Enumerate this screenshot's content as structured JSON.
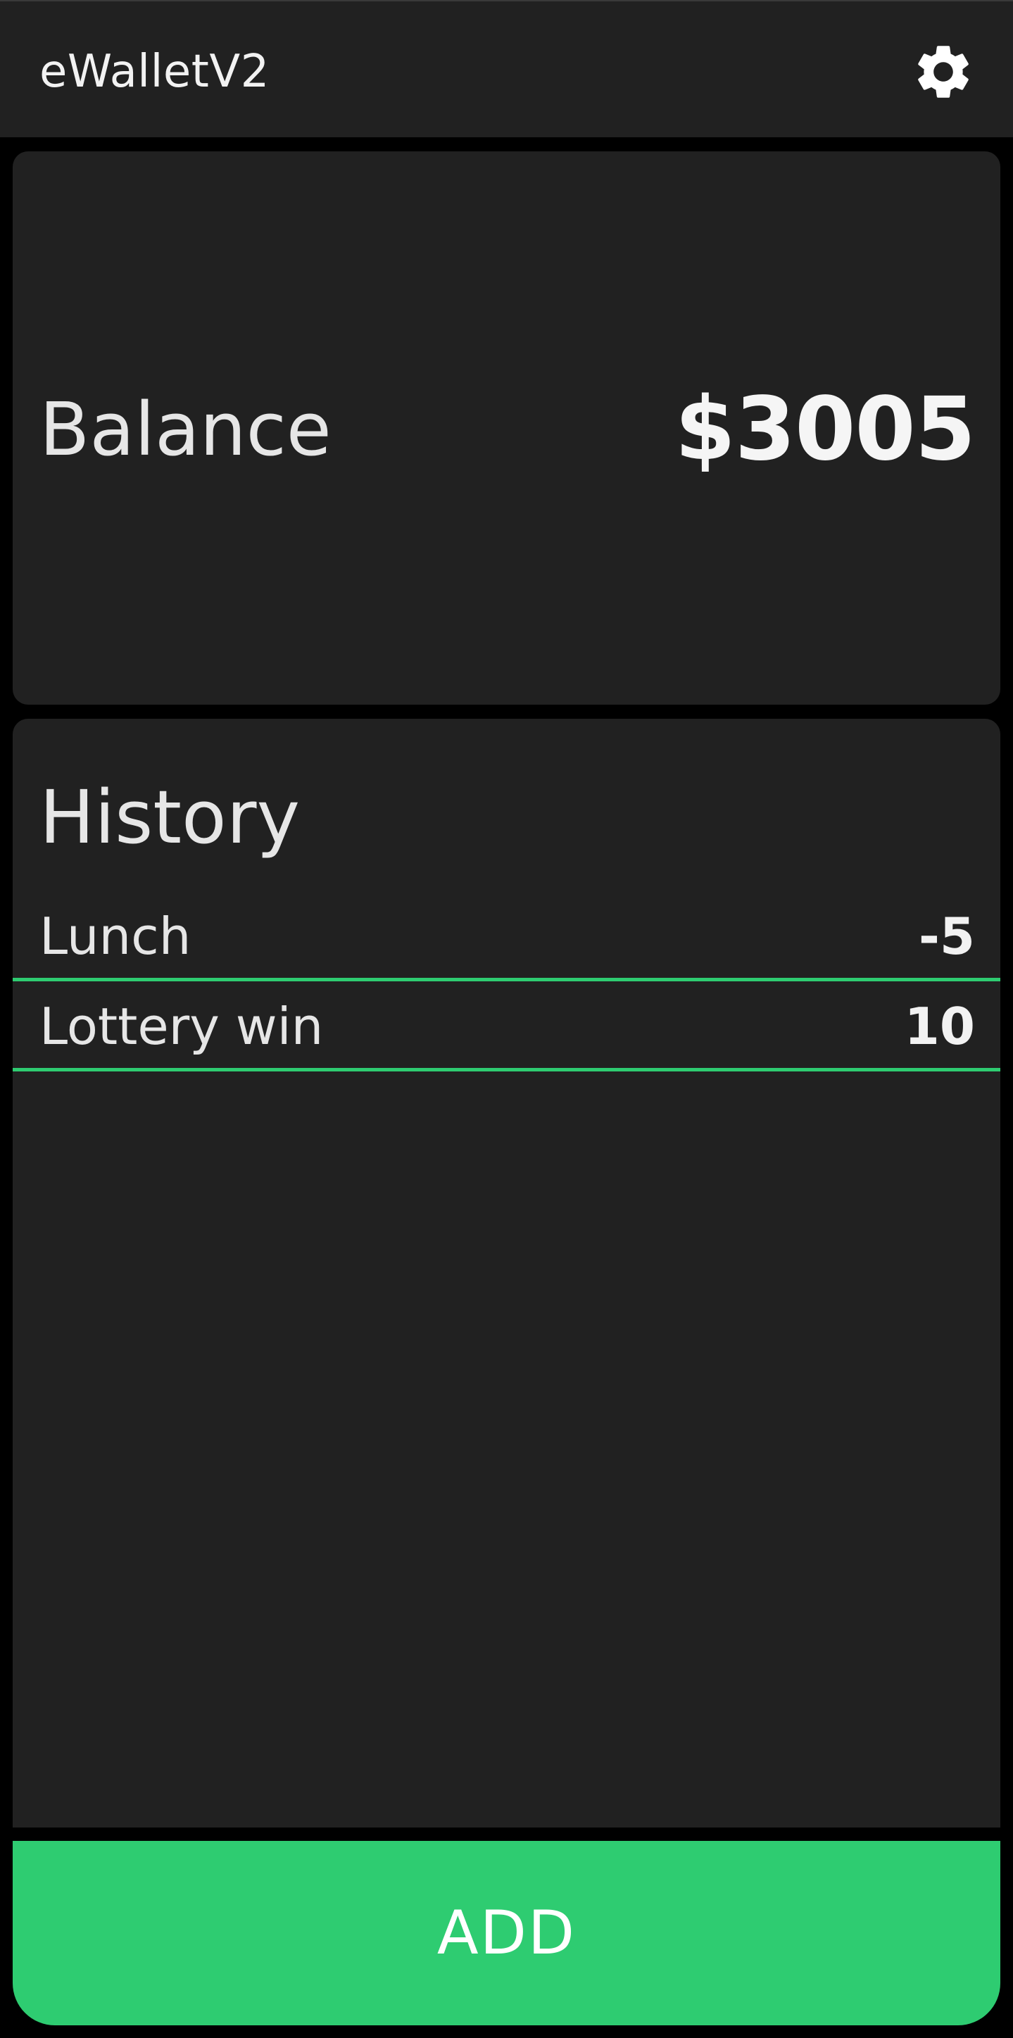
{
  "app_bar": {
    "title": "eWalletV2",
    "settings_icon": "gear-icon"
  },
  "balance": {
    "label": "Balance",
    "value": "$3005"
  },
  "history": {
    "title": "History",
    "items": [
      {
        "label": "Lunch",
        "amount": "-5"
      },
      {
        "label": "Lottery win",
        "amount": "10"
      }
    ]
  },
  "add_button": {
    "label": "ADD"
  },
  "colors": {
    "background": "#000000",
    "surface": "#212121",
    "accent": "#2ecc71",
    "text": "#e6e6e6"
  }
}
